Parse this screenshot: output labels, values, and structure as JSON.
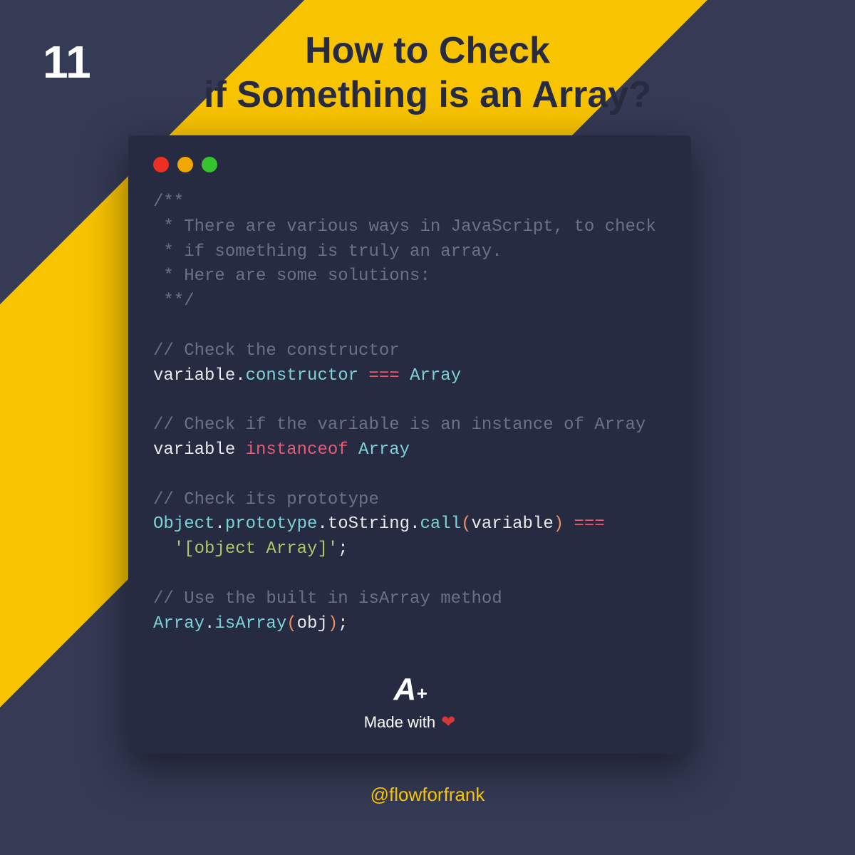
{
  "page_number": "11",
  "title_line1": "How to Check",
  "title_line2": "if Something is an Array?",
  "code": {
    "block1": {
      "l1": "/**",
      "l2": " * There are various ways in JavaScript, to check",
      "l3": " * if something is truly an array.",
      "l4": " * Here are some solutions:",
      "l5": " **/"
    },
    "block2": {
      "comment": "// Check the constructor",
      "var": "variable",
      "dot": ".",
      "prop": "constructor",
      "op": " === ",
      "cls": "Array"
    },
    "block3": {
      "comment": "// Check if the variable is an instance of Array",
      "var": "variable",
      "sp": " ",
      "kw": "instanceof",
      "cls": " Array"
    },
    "block4": {
      "comment": "// Check its prototype",
      "obj": "Object",
      "d1": ".",
      "proto": "prototype",
      "d2": ".",
      "tostr": "toString",
      "d3": ".",
      "call": "call",
      "op1": "(",
      "var": "variable",
      "op2": ")",
      "eq": " ===",
      "indent": "  ",
      "q1": "'",
      "str": "[object Array]",
      "q2": "'",
      "semi": ";"
    },
    "block5": {
      "comment": "// Use the built in isArray method",
      "arr": "Array",
      "d1": ".",
      "fn": "isArray",
      "op1": "(",
      "var": "obj",
      "op2": ")",
      "semi": ";"
    }
  },
  "logo_a": "A",
  "logo_plus": "+",
  "made_with": "Made with",
  "handle": "@flowforfrank"
}
